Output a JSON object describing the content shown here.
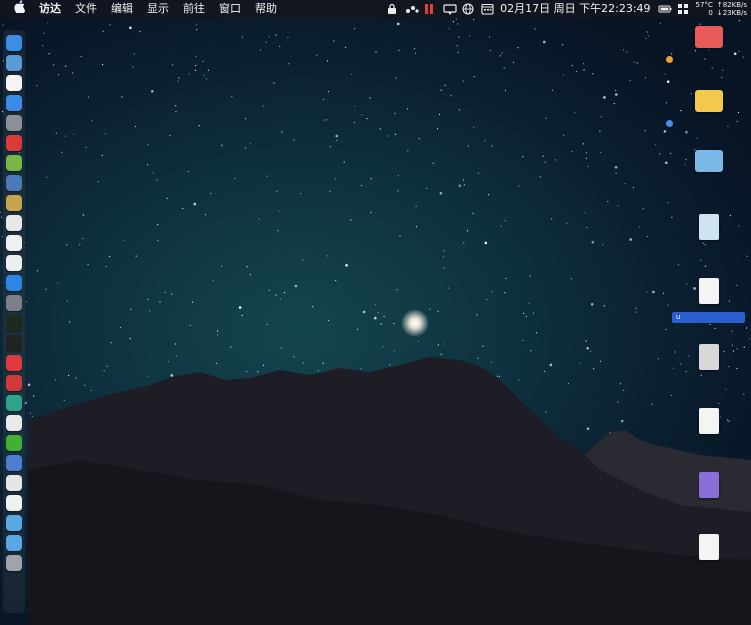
{
  "menubar": {
    "apple_icon": "apple-logo-icon",
    "app_name": "访达",
    "menus": [
      "文件",
      "编辑",
      "显示",
      "前往",
      "窗口",
      "帮助"
    ],
    "status_icons": [
      "lock-icon",
      "dots-icon",
      "pause-icon",
      "notification-icon",
      "globe-icon",
      "calendar-icon"
    ],
    "clock": "02月17日 周日 下午22:23:49",
    "cpu_temp": "57°C",
    "up_speed": "↑82KB/s",
    "cpu_load": "0",
    "down_speed": "↓23KB/s"
  },
  "dock": {
    "items": [
      {
        "name": "finder-icon",
        "color": "#3a8ee6"
      },
      {
        "name": "network-icon",
        "color": "#5a9ad8"
      },
      {
        "name": "calendar-icon",
        "color": "#f4f4f4"
      },
      {
        "name": "safari-icon",
        "color": "#3d8be8"
      },
      {
        "name": "launchpad-icon",
        "color": "#8b8f99"
      },
      {
        "name": "app-store-red-icon",
        "color": "#d93b3b"
      },
      {
        "name": "android-icon",
        "color": "#76b843"
      },
      {
        "name": "preview-icon",
        "color": "#4a7bb8"
      },
      {
        "name": "notes-icon",
        "color": "#c9a44a"
      },
      {
        "name": "photos-icon",
        "color": "#e8e8e8"
      },
      {
        "name": "textedit-icon",
        "color": "#f1f1f1"
      },
      {
        "name": "document-icon",
        "color": "#eeeeee"
      },
      {
        "name": "app-store-icon",
        "color": "#2b86e6"
      },
      {
        "name": "system-preferences-icon",
        "color": "#7d8088"
      },
      {
        "name": "activity-monitor-icon",
        "color": "#1d2a1d"
      },
      {
        "name": "terminal-icon",
        "color": "#222222"
      },
      {
        "name": "vivaldi-icon",
        "color": "#e0393e"
      },
      {
        "name": "netease-music-icon",
        "color": "#d23a3a"
      },
      {
        "name": "sync-icon",
        "color": "#2ea58a"
      },
      {
        "name": "yandex-browser-icon",
        "color": "#e9e9e9"
      },
      {
        "name": "wechat-icon",
        "color": "#41b035"
      },
      {
        "name": "screen-sharing-icon",
        "color": "#4d7ed1"
      },
      {
        "name": "script-editor-icon",
        "color": "#e6e6e6"
      },
      {
        "name": "qq-icon",
        "color": "#f0f0f0"
      },
      {
        "name": "folder-icon",
        "color": "#5aa7e6"
      },
      {
        "name": "downloads-folder-icon",
        "color": "#5aa7e6"
      },
      {
        "name": "trash-icon",
        "color": "#a0a4aa"
      }
    ]
  },
  "desktop": {
    "icons": [
      {
        "name": "red-folder-icon",
        "color": "#e85a5a",
        "kind": "folder",
        "label": ""
      },
      {
        "name": "yellow-folder-icon",
        "color": "#f2c94c",
        "kind": "folder",
        "label": ""
      },
      {
        "name": "blue-folder-icon",
        "color": "#7ab8e8",
        "kind": "folder",
        "label": ""
      },
      {
        "name": "shield-file-icon",
        "color": "#cfe3f0",
        "kind": "file",
        "label": ""
      },
      {
        "name": "blank-file-icon",
        "color": "#f4f4f4",
        "kind": "file",
        "label": ""
      },
      {
        "name": "screenshot-file-icon",
        "color": "#d8d8d8",
        "kind": "file",
        "label": ""
      },
      {
        "name": "document-file-icon",
        "color": "#f4f4f4",
        "kind": "file",
        "label": ""
      },
      {
        "name": "app-file-icon",
        "color": "#8a6fd8",
        "kind": "file",
        "label": ""
      },
      {
        "name": "text-file-icon",
        "color": "#f4f4f4",
        "kind": "file",
        "label": ""
      }
    ],
    "selected_label_prefix": "u",
    "tag_colors": {
      "orange": "#f0a030",
      "blue": "#4a90e2"
    }
  }
}
